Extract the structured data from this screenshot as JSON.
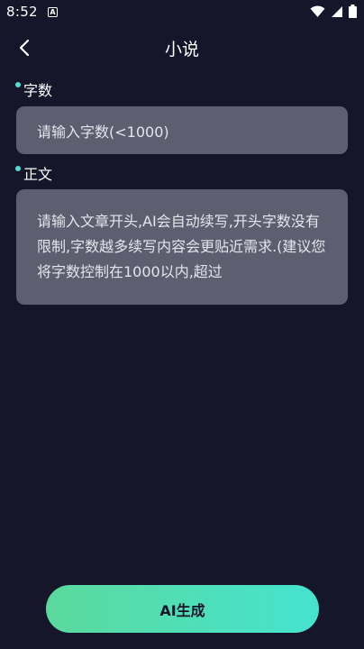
{
  "status_bar": {
    "time": "8:52",
    "notification_letter": "A",
    "icons": [
      "wifi-icon",
      "signal-icon",
      "battery-icon"
    ]
  },
  "header": {
    "title": "小说",
    "back_icon": "chevron-left-icon"
  },
  "form": {
    "word_count": {
      "label": "字数",
      "placeholder": "请输入字数(<1000)"
    },
    "body": {
      "label": "正文",
      "placeholder": "请输入文章开头,AI会自动续写,开头字数没有限制,字数越多续写内容会更贴近需求.(建议您将字数控制在1000以内,超过"
    }
  },
  "actions": {
    "generate_label": "AI生成"
  },
  "colors": {
    "background": "#15162a",
    "field": "#5d5f70",
    "accent_dot": "#4ee0d6",
    "button_gradient_start": "#5bd99c",
    "button_gradient_end": "#45e3d0"
  }
}
